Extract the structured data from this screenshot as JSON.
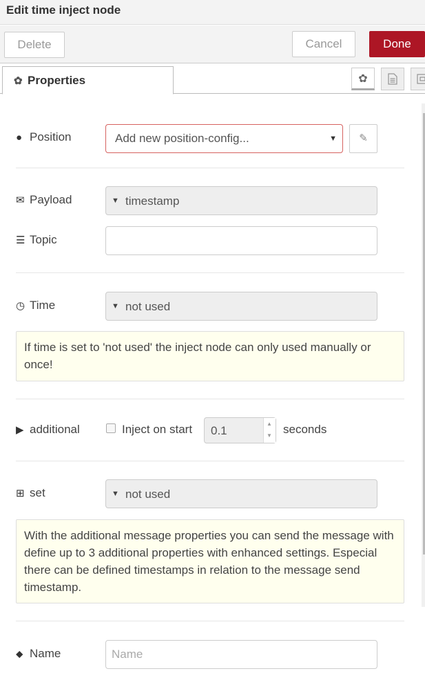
{
  "header": {
    "title": "Edit time inject node"
  },
  "toolbar": {
    "delete_label": "Delete",
    "cancel_label": "Cancel",
    "done_label": "Done",
    "done_color": "#ad1625"
  },
  "tabs": {
    "active_label": "Properties",
    "icons": [
      "gear-icon",
      "description-icon",
      "appearance-icon"
    ]
  },
  "form": {
    "position": {
      "label": "Position",
      "icon": "globe-icon",
      "selected": "Add new position-config..."
    },
    "payload": {
      "label": "Payload",
      "icon": "envelope-icon",
      "value": "timestamp"
    },
    "topic": {
      "label": "Topic",
      "icon": "tasks-icon",
      "value": ""
    },
    "time": {
      "label": "Time",
      "icon": "clock-icon",
      "value": "not used",
      "tip": "If time is set to 'not used' the inject node can only used manually or once!"
    },
    "additional": {
      "label": "additional",
      "icon": "play-circle-icon",
      "inject_on_start_label": "Inject on start",
      "inject_on_start_checked": false,
      "delay_value": "0.1",
      "seconds_label": "seconds"
    },
    "set": {
      "label": "set",
      "icon": "plus-square-icon",
      "value": "not used",
      "tip": "With the additional message properties you can send the message with define up to 3 additional properties with enhanced settings. Especial there can be defined timestamps in relation to the message send timestamp."
    },
    "name": {
      "label": "Name",
      "icon": "tag-icon",
      "value": "",
      "placeholder": "Name"
    }
  }
}
